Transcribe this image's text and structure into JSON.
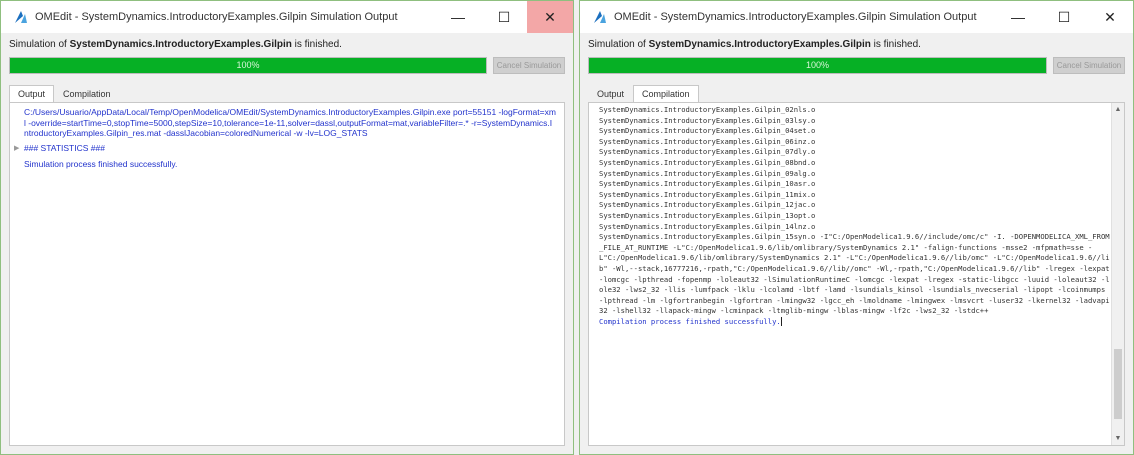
{
  "left": {
    "title": "OMEdit - SystemDynamics.IntroductoryExamples.Gilpin Simulation Output",
    "status_prefix": "Simulation of ",
    "status_model": "SystemDynamics.IntroductoryExamples.Gilpin",
    "status_suffix": " is finished.",
    "progress_percent": 100,
    "progress_label": "100%",
    "cancel_label": "Cancel Simulation",
    "tabs": [
      "Output",
      "Compilation"
    ],
    "active_tab": "Output",
    "command": "C:/Users/Usuario/AppData/Local/Temp/OpenModelica/OMEdit/SystemDynamics.IntroductoryExamples.Gilpin.exe port=55151 -logFormat=xml -override=startTime=0,stopTime=5000,stepSize=10,tolerance=1e-11,solver=dassl,outputFormat=mat,variableFilter=.* -r=SystemDynamics.IntroductoryExamples.Gilpin_res.mat -dasslJacobian=coloredNumerical -w -lv=LOG_STATS",
    "stats_label": "### STATISTICS ###",
    "result": "Simulation process finished successfully."
  },
  "right": {
    "title": "OMEdit - SystemDynamics.IntroductoryExamples.Gilpin Simulation Output",
    "status_prefix": "Simulation of ",
    "status_model": "SystemDynamics.IntroductoryExamples.Gilpin",
    "status_suffix": " is finished.",
    "progress_percent": 100,
    "progress_label": "100%",
    "cancel_label": "Cancel Simulation",
    "tabs": [
      "Output",
      "Compilation"
    ],
    "active_tab": "Compilation",
    "compilation_text": "SystemDynamics.IntroductoryExamples.Gilpin_02nls.o\nSystemDynamics.IntroductoryExamples.Gilpin_03lsy.o\nSystemDynamics.IntroductoryExamples.Gilpin_04set.o\nSystemDynamics.IntroductoryExamples.Gilpin_06inz.o\nSystemDynamics.IntroductoryExamples.Gilpin_07dly.o\nSystemDynamics.IntroductoryExamples.Gilpin_08bnd.o\nSystemDynamics.IntroductoryExamples.Gilpin_09alg.o\nSystemDynamics.IntroductoryExamples.Gilpin_10asr.o\nSystemDynamics.IntroductoryExamples.Gilpin_11mix.o\nSystemDynamics.IntroductoryExamples.Gilpin_12jac.o\nSystemDynamics.IntroductoryExamples.Gilpin_13opt.o\nSystemDynamics.IntroductoryExamples.Gilpin_14lnz.o\nSystemDynamics.IntroductoryExamples.Gilpin_15syn.o -I\"C:/OpenModelica1.9.6//include/omc/c\" -I. -DOPENMODELICA_XML_FROM_FILE_AT_RUNTIME -L\"C:/OpenModelica1.9.6/lib/omlibrary/SystemDynamics 2.1\" -falign-functions -msse2 -mfpmath=sse -L\"C:/OpenModelica1.9.6/lib/omlibrary/SystemDynamics 2.1\" -L\"C:/OpenModelica1.9.6//lib/omc\" -L\"C:/OpenModelica1.9.6//lib\" -Wl,--stack,16777216,-rpath,\"C:/OpenModelica1.9.6//lib//omc\" -Wl,-rpath,\"C:/OpenModelica1.9.6//lib\" -lregex -lexpat -lomcgc -lpthread -fopenmp -loleaut32 -lSimulationRuntimeC -lomcgc -lexpat -lregex -static-libgcc -luuid -loleaut32 -lole32 -lws2_32 -llis -lumfpack -lklu -lcolamd -lbtf -lamd -lsundials_kinsol -lsundials_nvecserial -lipopt -lcoinmumps -lpthread -lm -lgfortranbegin -lgfortran -lmingw32 -lgcc_eh -lmoldname -lmingwex -lmsvcrt -luser32 -lkernel32 -ladvapi32 -lshell32 -llapack-mingw -lcminpack -ltmglib-mingw -lblas-mingw -lf2c -lws2_32 -lstdc++",
    "result": "Compilation process finished successfully."
  }
}
